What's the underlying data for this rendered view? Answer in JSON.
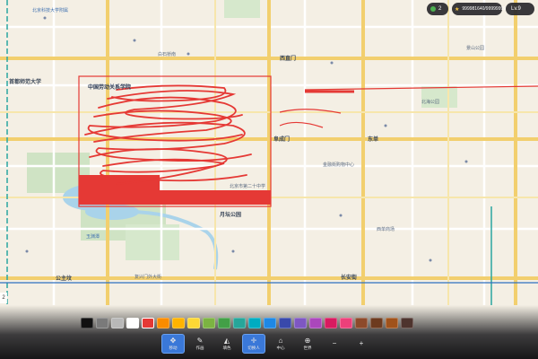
{
  "hud": {
    "level_count": "2",
    "score": "999981640/99999999",
    "level_label": "Lv.9"
  },
  "map": {
    "labels": {
      "drawn_box_label": "中国劳动关系学院",
      "school": "首都师范大学",
      "north_label": "北京科技大学附属",
      "park_east": "白石桥南",
      "mid_school": "北京市第二十中学",
      "station": "西直门",
      "south_road": "复兴门外大街",
      "east_road": "东单",
      "center_label": "月坛公园",
      "gate": "阜成门",
      "mall": "金融街购物中心",
      "lake": "玉渊潭",
      "hotel": "西单商场",
      "west_station": "公主坟",
      "beihai": "北海公园",
      "jingshan": "景山公园",
      "chang_an": "长安街"
    }
  },
  "palette": {
    "colors": [
      "#111111",
      "#7a7a7a",
      "#b8b8b8",
      "#ffffff",
      "#e53935",
      "#fb8c00",
      "#ffb300",
      "#fdd835",
      "#7cb342",
      "#43a047",
      "#26a69a",
      "#00acc1",
      "#1e88e5",
      "#3949ab",
      "#7e57c2",
      "#ab47bc",
      "#d81b60",
      "#ec407a",
      "#8d4a2b",
      "#6d3b1f",
      "#a0521b",
      "#4e342e"
    ],
    "selected_index": 4
  },
  "toolbar": {
    "tools": [
      {
        "icon": "move-icon",
        "label": "移动"
      },
      {
        "icon": "pencil-icon",
        "label": "作画"
      },
      {
        "icon": "bucket-icon",
        "label": "填色"
      },
      {
        "icon": "crosshair-icon",
        "label": "切换人"
      },
      {
        "icon": "home-icon",
        "label": "中心"
      },
      {
        "icon": "globe-icon",
        "label": "世界"
      },
      {
        "icon": "minus-icon",
        "label": ""
      },
      {
        "icon": "plus-icon",
        "label": ""
      }
    ],
    "active_index": 0,
    "selected_index": 3
  },
  "side": {
    "zoom_label": "2"
  }
}
